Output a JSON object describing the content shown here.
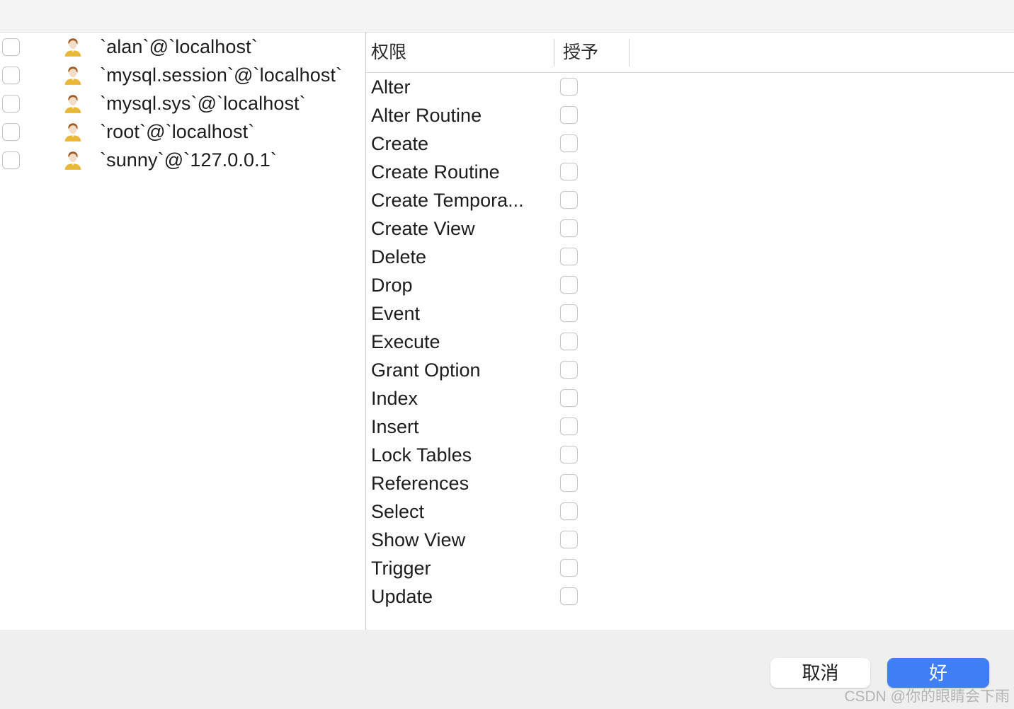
{
  "window": {
    "background_color": "#f1f1f1",
    "content_background": "#ffffff",
    "footer_background": "#efefef"
  },
  "user_list": {
    "name": "users-list",
    "rows": [
      {
        "label": "`alan`@`localhost`",
        "checked": false,
        "icon": "user-avatar-icon"
      },
      {
        "label": "`mysql.session`@`localhost`",
        "checked": false,
        "icon": "user-avatar-icon"
      },
      {
        "label": "`mysql.sys`@`localhost`",
        "checked": false,
        "icon": "user-avatar-icon"
      },
      {
        "label": "`root`@`localhost`",
        "checked": false,
        "icon": "user-avatar-icon"
      },
      {
        "label": "`sunny`@`127.0.0.1`",
        "checked": false,
        "icon": "user-avatar-icon"
      }
    ]
  },
  "permissions_table": {
    "headers": {
      "permission": "权限",
      "grant": "授予"
    },
    "rows": [
      {
        "name": "Alter",
        "granted": false
      },
      {
        "name": "Alter Routine",
        "granted": false
      },
      {
        "name": "Create",
        "granted": false
      },
      {
        "name": "Create Routine",
        "granted": false
      },
      {
        "name": "Create Tempora...",
        "granted": false
      },
      {
        "name": "Create View",
        "granted": false
      },
      {
        "name": "Delete",
        "granted": false
      },
      {
        "name": "Drop",
        "granted": false
      },
      {
        "name": "Event",
        "granted": false
      },
      {
        "name": "Execute",
        "granted": false
      },
      {
        "name": "Grant Option",
        "granted": false
      },
      {
        "name": "Index",
        "granted": false
      },
      {
        "name": "Insert",
        "granted": false
      },
      {
        "name": "Lock Tables",
        "granted": false
      },
      {
        "name": "References",
        "granted": false
      },
      {
        "name": "Select",
        "granted": false
      },
      {
        "name": "Show View",
        "granted": false
      },
      {
        "name": "Trigger",
        "granted": false
      },
      {
        "name": "Update",
        "granted": false
      }
    ]
  },
  "footer": {
    "cancel_label": "取消",
    "ok_label": "好",
    "ok_color": "#3f7ef5",
    "watermark": "CSDN @你的眼睛会下雨"
  }
}
